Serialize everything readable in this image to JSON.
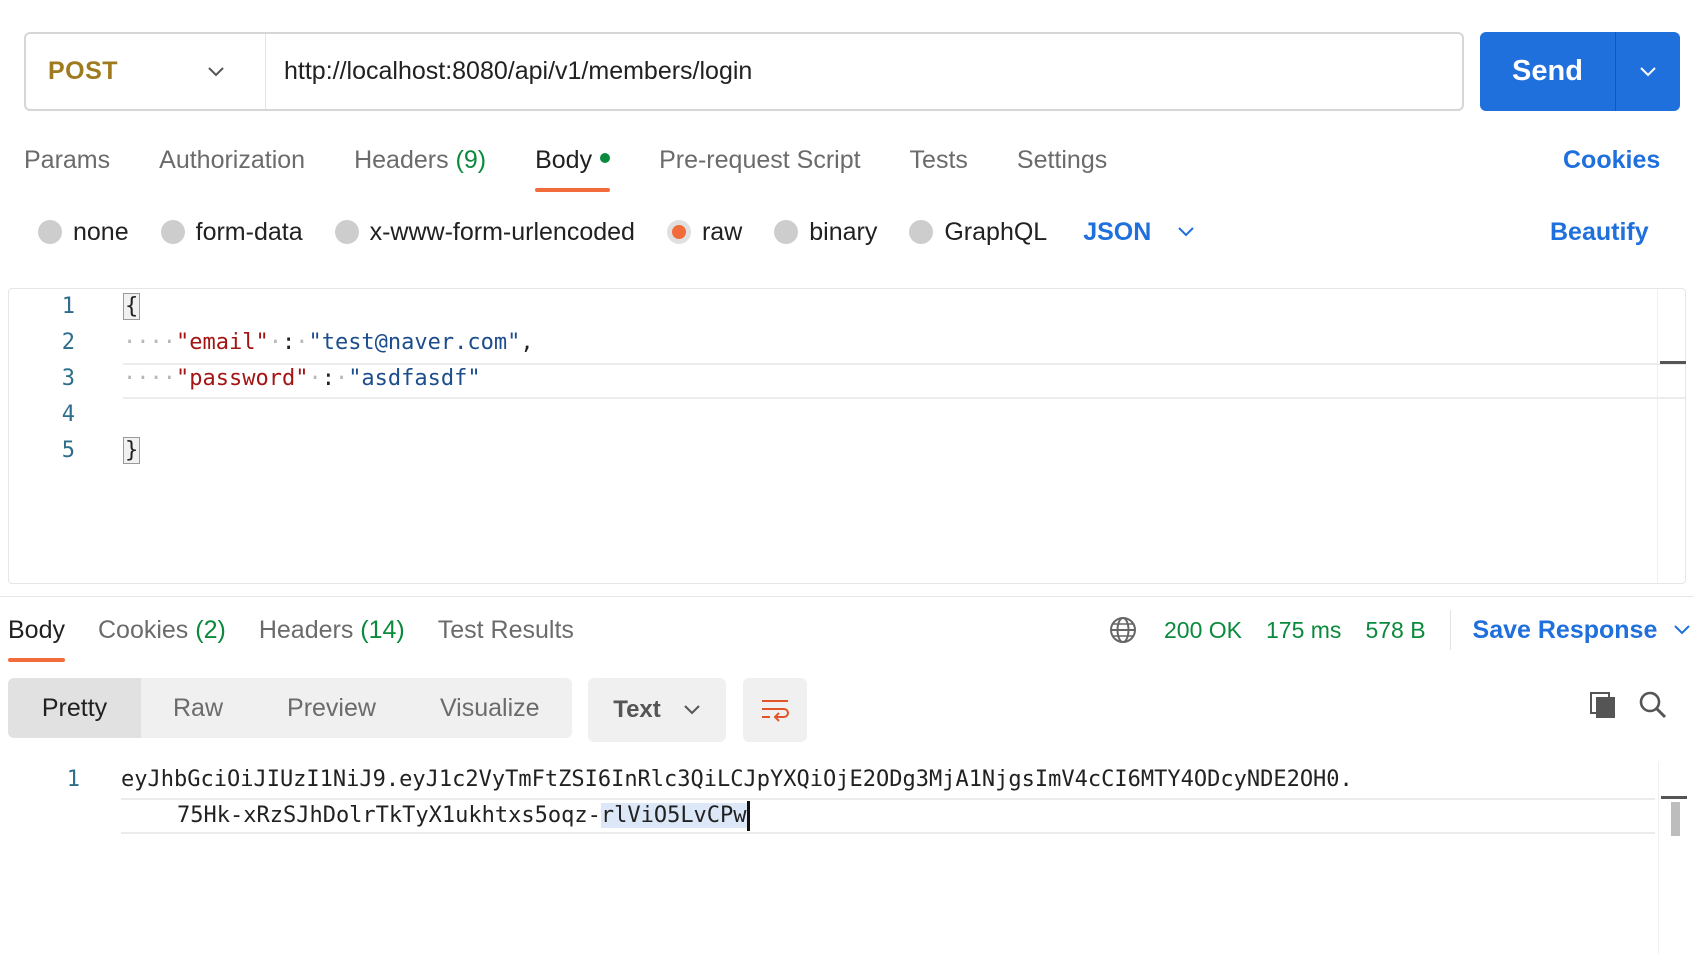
{
  "request": {
    "method": "POST",
    "url": "http://localhost:8080/api/v1/members/login",
    "send_label": "Send"
  },
  "request_tabs": {
    "params": "Params",
    "authorization": "Authorization",
    "headers": "Headers",
    "headers_count": "(9)",
    "body": "Body",
    "pre_request": "Pre-request Script",
    "tests": "Tests",
    "settings": "Settings",
    "cookies": "Cookies"
  },
  "body_types": {
    "none": "none",
    "form_data": "form-data",
    "urlencoded": "x-www-form-urlencoded",
    "raw": "raw",
    "binary": "binary",
    "graphql": "GraphQL",
    "format": "JSON",
    "beautify": "Beautify",
    "selected": "raw"
  },
  "editor": {
    "line_numbers": [
      "1",
      "2",
      "3",
      "4",
      "5"
    ],
    "open_brace": "{",
    "close_brace": "}",
    "email_key": "\"email\"",
    "email_value": "\"test@naver.com\"",
    "password_key": "\"password\"",
    "password_value": "\"asdfasdf\"",
    "colon": ":",
    "comma": ","
  },
  "response": {
    "tabs": {
      "body": "Body",
      "cookies": "Cookies",
      "cookies_count": "(2)",
      "headers": "Headers",
      "headers_count": "(14)",
      "test_results": "Test Results"
    },
    "status": "200 OK",
    "time": "175 ms",
    "size": "578 B",
    "save_response": "Save Response",
    "views": {
      "pretty": "Pretty",
      "raw": "Raw",
      "preview": "Preview",
      "visualize": "Visualize"
    },
    "text_format": "Text",
    "line_number": "1",
    "token_line1": "eyJhbGciOiJIUzI1NiJ9.eyJ1c2VyTmFtZSI6InRlc3QiLCJpYXQiOjE2ODg3MjA1NjgsImV4cCI6MTY4ODcyNDE2OH0.",
    "token_line2_plain": "75Hk-xRzSJhDolrTkTyX1ukhtxs5oqz-",
    "token_line2_selected": "rlViO5LvCPw"
  },
  "colors": {
    "accent_blue": "#1f6fdc",
    "method_gold": "#a07a1f",
    "success_green": "#0a8a3c",
    "active_orange": "#f26b3a"
  }
}
